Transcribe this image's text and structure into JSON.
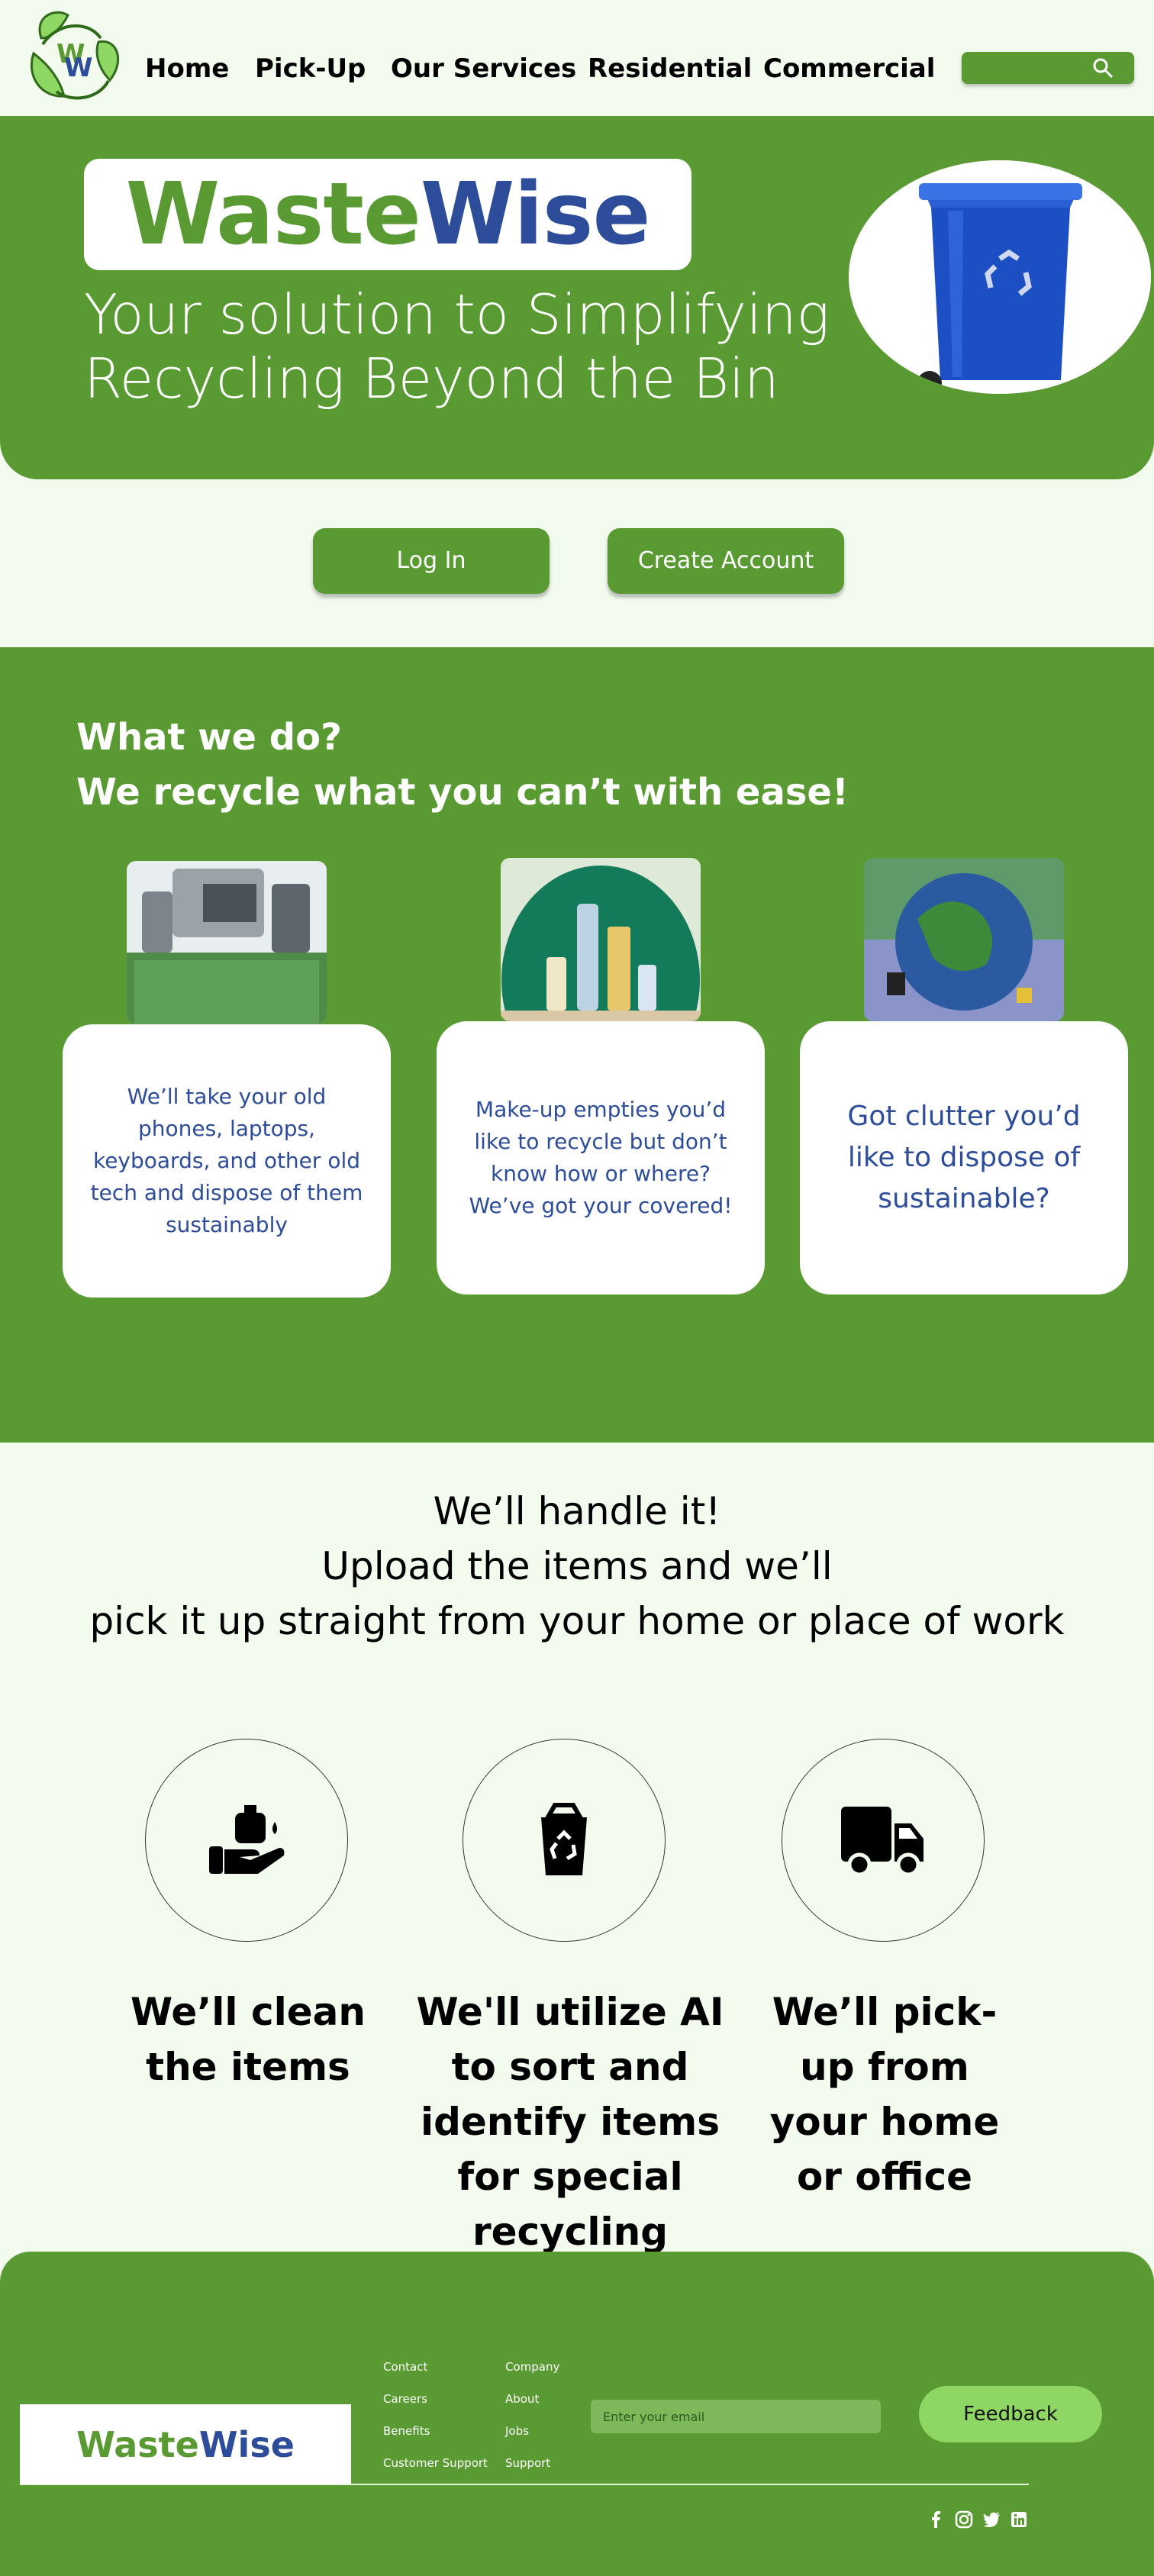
{
  "nav": {
    "links": [
      "Home",
      "Pick-Up",
      "Our Services",
      "Residential",
      "Commercial"
    ]
  },
  "hero": {
    "brand_part1": "Waste",
    "brand_part2": "Wise",
    "tagline_line1": "Your solution to Simplifying",
    "tagline_line2": "Recycling Beyond the Bin"
  },
  "auth": {
    "login_label": "Log In",
    "create_label": "Create Account"
  },
  "what": {
    "heading1": "What we do?",
    "heading2": "We recycle what you can’t with ease!",
    "cards": [
      {
        "text": "We’ll take your old phones, laptops, keyboards, and other old tech and dispose of them sustainably"
      },
      {
        "text": "Make-up empties you’d like to recycle but don’t know how or where? We’ve got your covered!"
      },
      {
        "text": "Got clutter you’d like to dispose of sustainable?"
      }
    ]
  },
  "handle": {
    "line1": "We’ll handle it!",
    "line2": "Upload the items and we’ll",
    "line3": "pick it up straight from your home or place of work"
  },
  "steps": [
    {
      "label": "We’ll clean the items",
      "icon": "hand-wash-icon"
    },
    {
      "label": "We'll utilize AI to sort and identify items for special recycling",
      "icon": "recycle-bag-icon"
    },
    {
      "label": "We’ll pick-up from your home or office",
      "icon": "truck-icon"
    }
  ],
  "footer": {
    "brand_part1": "WasteWise",
    "brand_part2": "",
    "col1": [
      "Contact",
      "Careers",
      "Benefits",
      "Customer Support"
    ],
    "col2": [
      "Company",
      "About",
      "Jobs",
      "Support"
    ],
    "email_placeholder": "Enter your email",
    "feedback_label": "Feedback",
    "social": [
      "facebook-icon",
      "instagram-icon",
      "twitter-icon",
      "linkedin-icon"
    ]
  },
  "colors": {
    "brand_green": "#5a9a32",
    "brand_blue": "#2d4d9a",
    "page_bg": "#f3fbef",
    "feedback_green": "#8fd765"
  }
}
